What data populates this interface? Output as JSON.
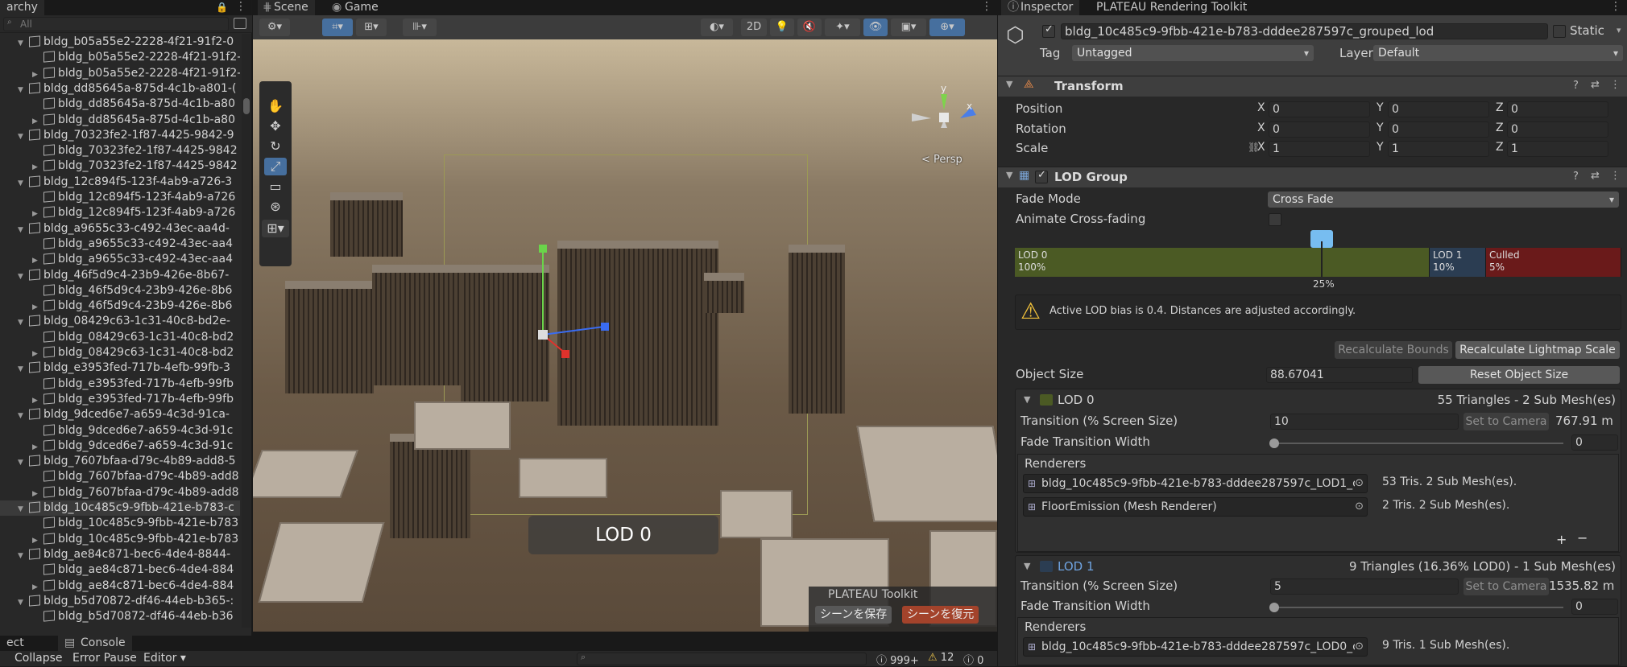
{
  "hierarchy": {
    "tab": "archy",
    "search_placeholder": "All",
    "rows": [
      {
        "indent": 1,
        "exp": "▼",
        "label": "bldg_b05a55e2-2228-4f21-91f2-0"
      },
      {
        "indent": 2,
        "exp": "",
        "label": "bldg_b05a55e2-2228-4f21-91f2-"
      },
      {
        "indent": 2,
        "exp": "▶",
        "label": "bldg_b05a55e2-2228-4f21-91f2-"
      },
      {
        "indent": 1,
        "exp": "▼",
        "label": "bldg_dd85645a-875d-4c1b-a801-("
      },
      {
        "indent": 2,
        "exp": "",
        "label": "bldg_dd85645a-875d-4c1b-a80"
      },
      {
        "indent": 2,
        "exp": "▶",
        "label": "bldg_dd85645a-875d-4c1b-a80"
      },
      {
        "indent": 1,
        "exp": "▼",
        "label": "bldg_70323fe2-1f87-4425-9842-9"
      },
      {
        "indent": 2,
        "exp": "",
        "label": "bldg_70323fe2-1f87-4425-9842"
      },
      {
        "indent": 2,
        "exp": "▶",
        "label": "bldg_70323fe2-1f87-4425-9842"
      },
      {
        "indent": 1,
        "exp": "▼",
        "label": "bldg_12c894f5-123f-4ab9-a726-3"
      },
      {
        "indent": 2,
        "exp": "",
        "label": "bldg_12c894f5-123f-4ab9-a726"
      },
      {
        "indent": 2,
        "exp": "▶",
        "label": "bldg_12c894f5-123f-4ab9-a726"
      },
      {
        "indent": 1,
        "exp": "▼",
        "label": "bldg_a9655c33-c492-43ec-aa4d-"
      },
      {
        "indent": 2,
        "exp": "",
        "label": "bldg_a9655c33-c492-43ec-aa4"
      },
      {
        "indent": 2,
        "exp": "▶",
        "label": "bldg_a9655c33-c492-43ec-aa4"
      },
      {
        "indent": 1,
        "exp": "▼",
        "label": "bldg_46f5d9c4-23b9-426e-8b67-"
      },
      {
        "indent": 2,
        "exp": "",
        "label": "bldg_46f5d9c4-23b9-426e-8b6"
      },
      {
        "indent": 2,
        "exp": "▶",
        "label": "bldg_46f5d9c4-23b9-426e-8b6"
      },
      {
        "indent": 1,
        "exp": "▼",
        "label": "bldg_08429c63-1c31-40c8-bd2e-"
      },
      {
        "indent": 2,
        "exp": "",
        "label": "bldg_08429c63-1c31-40c8-bd2"
      },
      {
        "indent": 2,
        "exp": "▶",
        "label": "bldg_08429c63-1c31-40c8-bd2"
      },
      {
        "indent": 1,
        "exp": "▼",
        "label": "bldg_e3953fed-717b-4efb-99fb-3"
      },
      {
        "indent": 2,
        "exp": "",
        "label": "bldg_e3953fed-717b-4efb-99fb"
      },
      {
        "indent": 2,
        "exp": "▶",
        "label": "bldg_e3953fed-717b-4efb-99fb"
      },
      {
        "indent": 1,
        "exp": "▼",
        "label": "bldg_9dced6e7-a659-4c3d-91ca-"
      },
      {
        "indent": 2,
        "exp": "",
        "label": "bldg_9dced6e7-a659-4c3d-91c"
      },
      {
        "indent": 2,
        "exp": "▶",
        "label": "bldg_9dced6e7-a659-4c3d-91c"
      },
      {
        "indent": 1,
        "exp": "▼",
        "label": "bldg_7607bfaa-d79c-4b89-add8-5"
      },
      {
        "indent": 2,
        "exp": "",
        "label": "bldg_7607bfaa-d79c-4b89-add8"
      },
      {
        "indent": 2,
        "exp": "▶",
        "label": "bldg_7607bfaa-d79c-4b89-add8"
      },
      {
        "indent": 1,
        "exp": "▼",
        "label": "bldg_10c485c9-9fbb-421e-b783-c",
        "selected": true
      },
      {
        "indent": 2,
        "exp": "",
        "label": "bldg_10c485c9-9fbb-421e-b783"
      },
      {
        "indent": 2,
        "exp": "▶",
        "label": "bldg_10c485c9-9fbb-421e-b783"
      },
      {
        "indent": 1,
        "exp": "▼",
        "label": "bldg_ae84c871-bec6-4de4-8844-"
      },
      {
        "indent": 2,
        "exp": "",
        "label": "bldg_ae84c871-bec6-4de4-884"
      },
      {
        "indent": 2,
        "exp": "▶",
        "label": "bldg_ae84c871-bec6-4de4-884"
      },
      {
        "indent": 1,
        "exp": "▼",
        "label": "bldg_b5d70872-df46-44eb-b365-:"
      },
      {
        "indent": 2,
        "exp": "",
        "label": "bldg_b5d70872-df46-44eb-b36"
      }
    ]
  },
  "scene": {
    "tab_scene": "Scene",
    "tab_game": "Game",
    "btn_2d": "2D",
    "persp": "< Persp",
    "lod_label": "LOD 0",
    "overlay_title": "PLATEAU Toolkit",
    "save_scene": "シーンを保存",
    "restore_scene": "シーンを復元",
    "axis_y": "y",
    "axis_x": "x"
  },
  "bottom": {
    "tab_project": "ect",
    "tab_console": "Console",
    "collapse": "Collapse",
    "error_pause": "Error Pause",
    "editor": "Editor",
    "count_info": "999+",
    "count_warn": "12",
    "count_err": "0"
  },
  "inspector": {
    "tab_inspector": "Inspector",
    "tab_plateau": "PLATEAU Rendering Toolkit",
    "object_name": "bldg_10c485c9-9fbb-421e-b783-dddee287597c_grouped_lod",
    "static": "Static",
    "tag_label": "Tag",
    "tag_value": "Untagged",
    "layer_label": "Layer",
    "layer_value": "Default",
    "transform": {
      "title": "Transform",
      "position": "Position",
      "rotation": "Rotation",
      "scale": "Scale",
      "pos": [
        "0",
        "0",
        "0"
      ],
      "rot": [
        "0",
        "0",
        "0"
      ],
      "scl": [
        "1",
        "1",
        "1"
      ],
      "x": "X",
      "y": "Y",
      "z": "Z"
    },
    "lodgroup": {
      "title": "LOD Group",
      "fade_mode": "Fade Mode",
      "fade_mode_value": "Cross Fade",
      "animate": "Animate Cross-fading",
      "bar": [
        {
          "name": "LOD 0",
          "pct": "100%",
          "color": "#4b5a24"
        },
        {
          "name": "LOD 1",
          "pct": "10%",
          "color": "#2b3d52"
        },
        {
          "name": "Culled",
          "pct": "5%",
          "color": "#6a1a1a"
        }
      ],
      "camera_pct": "25%",
      "warning": "Active LOD bias is 0.4. Distances are adjusted accordingly.",
      "recalc_bounds": "Recalculate Bounds",
      "recalc_lightmap": "Recalculate Lightmap Scale",
      "object_size_label": "Object Size",
      "object_size": "88.67041",
      "reset_size": "Reset Object Size"
    },
    "lod0": {
      "title": "LOD 0",
      "summary": "55 Triangles  - 2 Sub Mesh(es)",
      "transition_label": "Transition (% Screen Size)",
      "transition": "10",
      "set_camera": "Set to Camera",
      "distance": "767.91 m",
      "fade_label": "Fade Transition Width",
      "fade": "0",
      "renderers": "Renderers",
      "rows": [
        {
          "name": "bldg_10c485c9-9fbb-421e-b783-dddee287597c_LOD1_c",
          "info": "53 Tris. 2 Sub Mesh(es)."
        },
        {
          "name": "FloorEmission (Mesh Renderer)",
          "info": "2 Tris. 2 Sub Mesh(es)."
        }
      ]
    },
    "lod1": {
      "title": "LOD 1",
      "summary": "9 Triangles (16.36% LOD0) - 1 Sub Mesh(es)",
      "transition_label": "Transition (% Screen Size)",
      "transition": "5",
      "set_camera": "Set to Camera",
      "distance": "1535.82 m",
      "fade_label": "Fade Transition Width",
      "fade": "0",
      "renderers": "Renderers",
      "rows": [
        {
          "name": "bldg_10c485c9-9fbb-421e-b783-dddee287597c_LOD0_c",
          "info": "9 Tris. 1 Sub Mesh(es)."
        }
      ]
    }
  }
}
